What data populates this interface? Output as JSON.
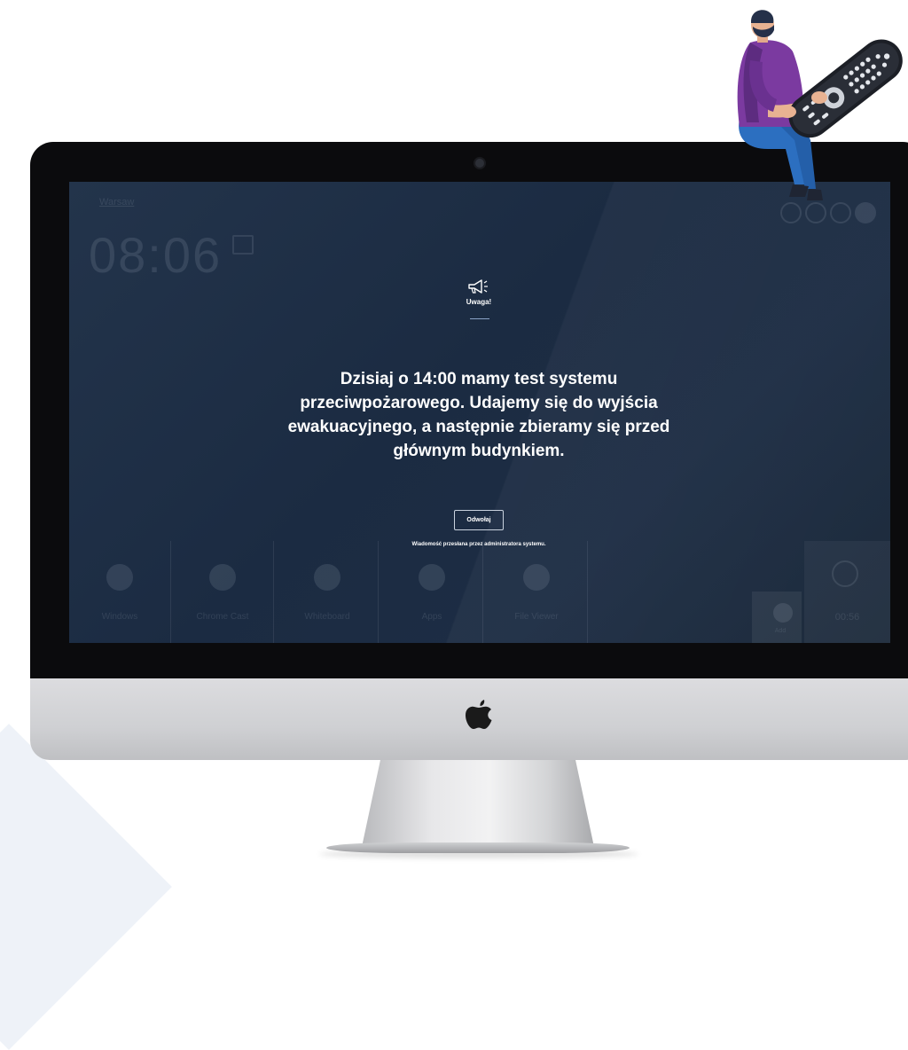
{
  "background_ui": {
    "room_label": "Warsaw",
    "clock": "08:06",
    "tiles": [
      {
        "label": "Windows",
        "icon": "monitor-icon"
      },
      {
        "label": "Chrome Cast",
        "icon": "cast-icon"
      },
      {
        "label": "Whiteboard",
        "icon": "whiteboard-icon"
      },
      {
        "label": "Apps",
        "icon": "grid-icon"
      },
      {
        "label": "File Viewer",
        "icon": "folder-icon"
      }
    ],
    "add_label": "Add",
    "timer": "00:56"
  },
  "alert": {
    "icon": "megaphone-icon",
    "title": "Uwaga!",
    "message_lines": [
      "Dzisiaj o 14:00 mamy test systemu",
      "przeciwpożarowego. Udajemy się do wyjścia",
      "ewakuacyjnego, a następnie zbieramy się przed",
      "głównym budynkiem."
    ],
    "cancel_label": "Odwołaj",
    "footer": "Wiadomość przesłana przez administratora systemu."
  },
  "colors": {
    "screen_bg": "#1f2f46",
    "accent_underline": "#8aa3c6"
  }
}
